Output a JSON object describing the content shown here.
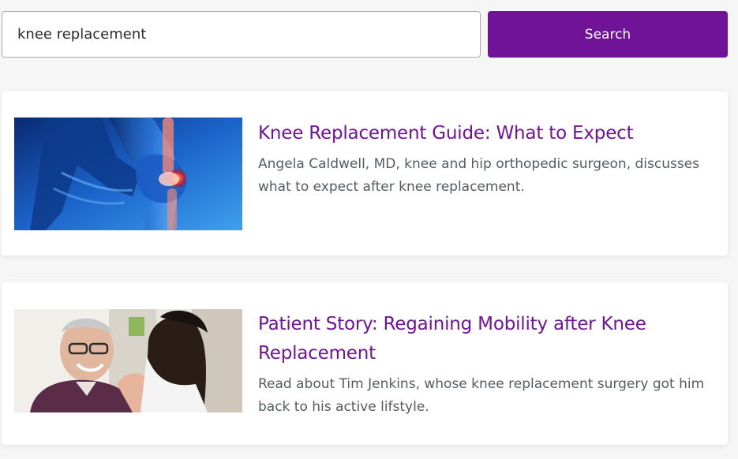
{
  "search": {
    "value": "knee replacement",
    "button_label": "Search"
  },
  "results": [
    {
      "title": "Knee Replacement Guide: What to Expect",
      "description": "Angela Caldwell, MD, knee and hip orthopedic surgeon, discusses what to expect after knee replacement.",
      "image": "knee-xray-illustration"
    },
    {
      "title": "Patient Story: Regaining Mobility after Knee Replacement",
      "description": "Read about Tim Jenkins, whose knee replacement surgery got him back to his active lifstyle.",
      "image": "doctor-patient-photo"
    }
  ],
  "colors": {
    "accent": "#701398",
    "background": "#f6f6f7",
    "card": "#ffffff",
    "body_text": "#555b60"
  }
}
